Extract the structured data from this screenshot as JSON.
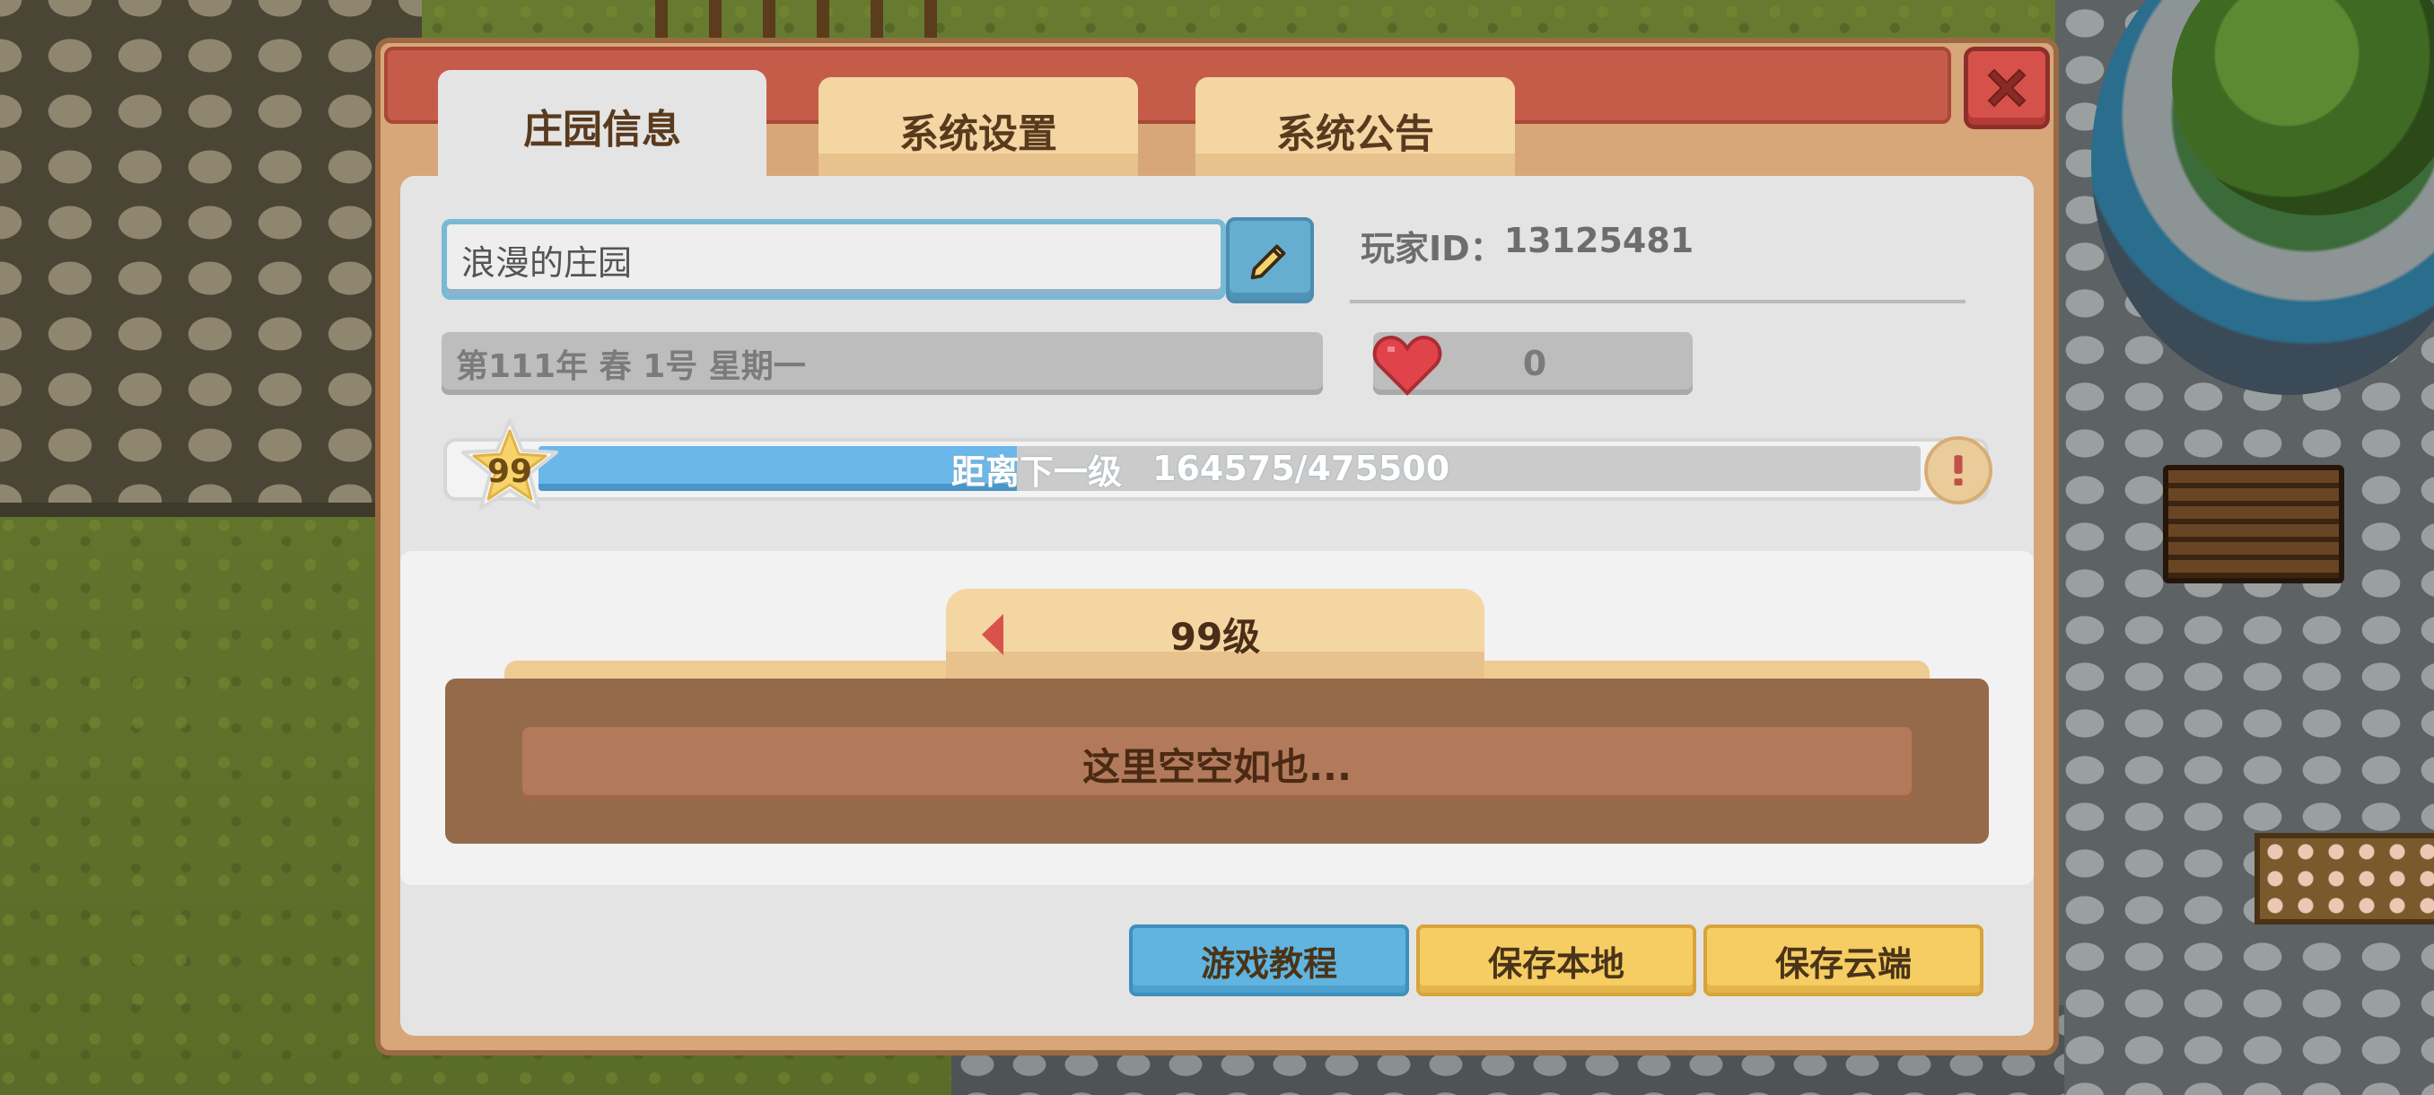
{
  "tabs": [
    {
      "label": "庄园信息",
      "active": true
    },
    {
      "label": "系统设置",
      "active": false
    },
    {
      "label": "系统公告",
      "active": false
    }
  ],
  "close_icon": "close-icon",
  "farm": {
    "name": "浪漫的庄园",
    "edit_icon": "pencil-icon"
  },
  "player": {
    "id_label": "玩家ID：",
    "id_value": "13125481"
  },
  "date_text": "第111年  春  1号 星期一",
  "likes": {
    "icon": "heart-icon",
    "count": "0"
  },
  "level": {
    "badge": "99",
    "xp_label": "距离下一级",
    "xp_text": "164575/475500",
    "xp_current": 164575,
    "xp_required": 475500,
    "info_icon": "exclamation-icon"
  },
  "level_reward": {
    "title": "99级",
    "empty_text": "这里空空如也..."
  },
  "buttons": {
    "tutorial": "游戏教程",
    "save_local": "保存本地",
    "save_cloud": "保存云端"
  },
  "colors": {
    "accent_blue": "#61b4e0",
    "accent_yellow": "#f5cd63",
    "title_bar_red": "#c55c4a",
    "xp_fill": "#6ab7ea"
  }
}
